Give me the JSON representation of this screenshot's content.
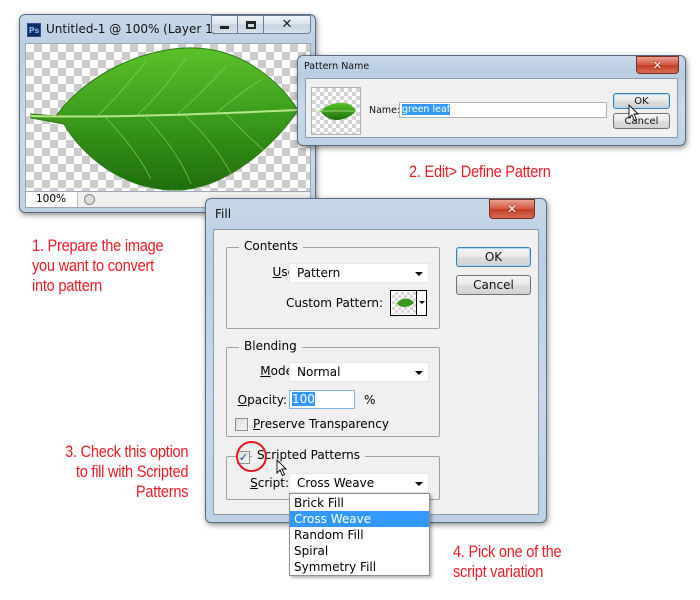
{
  "ps_document": {
    "logo": "Ps",
    "title": "Untitled-1 @ 100% (Layer 1, ...",
    "minimize_icon": "minimize-icon",
    "maximize_icon": "maximize-icon",
    "close_icon": "close-icon",
    "zoom_level": "100%",
    "canvas_content": "green leaf on transparent background"
  },
  "pattern_name_dialog": {
    "title": "Pattern Name",
    "name_label": "Name:",
    "name_value": "green leaf",
    "ok_label": "OK",
    "cancel_label": "Cancel"
  },
  "fill_dialog": {
    "title": "Fill",
    "contents_legend": "Contents",
    "use_label_u": "U",
    "use_label_rest": "se:",
    "use_value": "Pattern",
    "custom_pattern_label": "Custom Pattern:",
    "blending_legend": "Blending",
    "mode_label_u": "M",
    "mode_label_rest": "ode:",
    "mode_value": "Normal",
    "opacity_label_u": "O",
    "opacity_label_rest": "pacity:",
    "opacity_value": "100",
    "opacity_unit": "%",
    "preserve_label_u": "P",
    "preserve_label_rest": "reserve Transparency",
    "preserve_checked": false,
    "scripted_label": "Scripted Patterns",
    "scripted_checked": true,
    "script_label_u": "S",
    "script_label_rest": "cript:",
    "script_value": "Cross Weave",
    "ok_label": "OK",
    "cancel_label": "Cancel",
    "script_options": [
      "Brick Fill",
      "Cross Weave",
      "Random Fill",
      "Spiral",
      "Symmetry Fill"
    ],
    "script_selected_index": 1
  },
  "annotations": {
    "step1": [
      "1. Prepare the image",
      "you want to convert",
      "into pattern"
    ],
    "step2": "2. Edit> Define Pattern",
    "step3": [
      "3. Check this option",
      "to fill with Scripted",
      "Patterns"
    ],
    "step4": [
      "4. Pick one of the",
      "script variation"
    ]
  },
  "colors": {
    "annotation_red": "#ee1b24",
    "selection_blue": "#3399ff",
    "leaf_green": "#3a9a1c"
  }
}
